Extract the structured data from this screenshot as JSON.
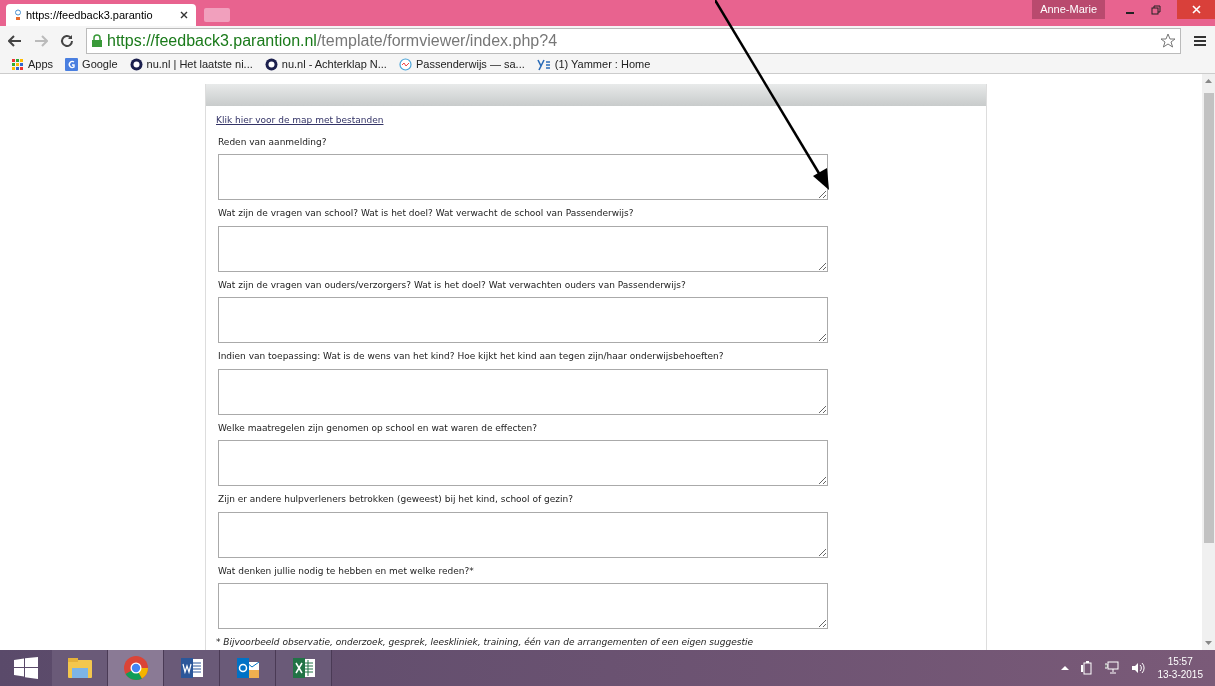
{
  "browser": {
    "tab_title": "https://feedback3.parantio",
    "url_host": "https://feedback3.parantion.nl",
    "url_path": "/template/formviewer/index.php?4",
    "user": "Anne-Marie"
  },
  "bookmarks": [
    {
      "label": "Apps",
      "kind": "apps"
    },
    {
      "label": "Google",
      "kind": "google"
    },
    {
      "label": "nu.nl | Het laatste ni...",
      "kind": "nu"
    },
    {
      "label": "nu.nl - Achterklap N...",
      "kind": "nu"
    },
    {
      "label": "Passenderwijs — sa...",
      "kind": "circle"
    },
    {
      "label": "(1) Yammer : Home",
      "kind": "yammer"
    }
  ],
  "form": {
    "link": "Klik hier voor de map met bestanden",
    "questions": [
      "Reden van aanmelding?",
      "Wat zijn de vragen van school? Wat is het doel? Wat verwacht de school van Passenderwijs?",
      "Wat zijn de vragen van ouders/verzorgers? Wat is het doel? Wat verwachten ouders van Passenderwijs?",
      "Indien van toepassing: Wat is de wens van het kind? Hoe kijkt het kind aan tegen zijn/haar onderwijsbehoeften?",
      "Welke maatregelen zijn genomen op school en wat waren de effecten?",
      "Zijn er andere hulpverleners betrokken (geweest) bij het kind, school of gezin?",
      "Wat denken jullie nodig te hebben en met welke reden?*"
    ],
    "footnote": "* Bijvoorbeeld observatie, onderzoek, gesprek, leeskliniek, training, één van de arrangementen of een eigen suggestie"
  },
  "taskbar": {
    "apps": [
      {
        "kind": "explorer",
        "selected": false
      },
      {
        "kind": "chrome",
        "selected": true
      },
      {
        "kind": "word",
        "selected": false
      },
      {
        "kind": "outlook",
        "selected": false
      },
      {
        "kind": "excel",
        "selected": false
      }
    ],
    "time": "15:57",
    "date": "13-3-2015"
  }
}
